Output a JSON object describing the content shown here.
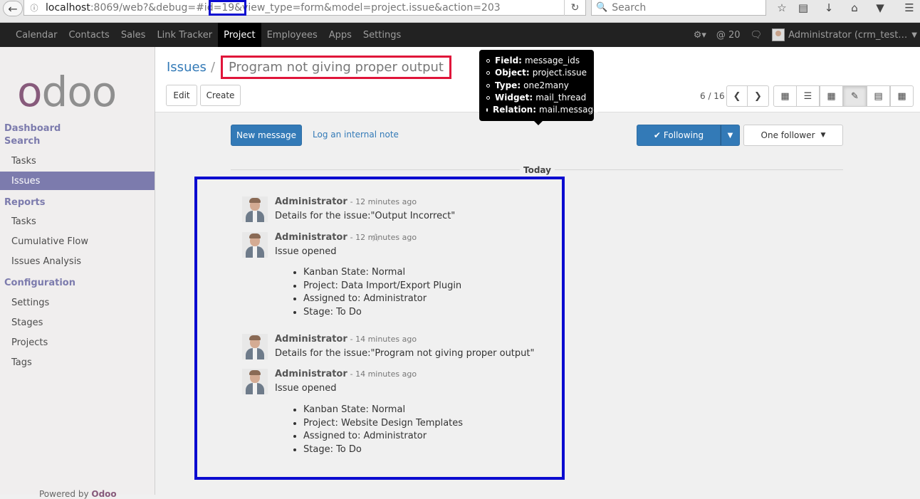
{
  "browser": {
    "url_host": "localhost",
    "url_rest": ":8069/web?&debug=#id=19&view_type=form&model=project.issue&action=203",
    "search_placeholder": "Search",
    "icons": [
      "back-arrow-icon",
      "info-icon",
      "reload-icon",
      "search-icon",
      "bookmark-star-icon",
      "reading-list-icon",
      "download-icon",
      "home-icon",
      "pocket-icon",
      "hamburger-menu-icon"
    ]
  },
  "topnav": {
    "items": [
      "Calendar",
      "Contacts",
      "Sales",
      "Link Tracker",
      "Project",
      "Employees",
      "Apps",
      "Settings"
    ],
    "active": "Project",
    "mentions_count": "@ 20",
    "user_label": "Administrator (crm_test…",
    "debug_icon": "bug-icon"
  },
  "sidebar": {
    "logo_text": "odoo",
    "dashboard": "Dashboard",
    "search": "Search",
    "section1_items": [
      "Tasks",
      "Issues"
    ],
    "reports": "Reports",
    "reports_items": [
      "Tasks",
      "Cumulative Flow",
      "Issues Analysis"
    ],
    "configuration": "Configuration",
    "config_items": [
      "Settings",
      "Stages",
      "Projects",
      "Tags"
    ],
    "powered_by": "Powered by",
    "powered_brand": "Odoo"
  },
  "control_panel": {
    "breadcrumb_parent": "Issues",
    "breadcrumb_sep": "/",
    "record_title": "Program not giving proper output",
    "edit_label": "Edit",
    "create_label": "Create",
    "pager": "6 / 16"
  },
  "tooltip": {
    "rows": [
      {
        "k": "Field:",
        "v": "message_ids"
      },
      {
        "k": "Object:",
        "v": "project.issue"
      },
      {
        "k": "Type:",
        "v": "one2many"
      },
      {
        "k": "Widget:",
        "v": "mail_thread"
      },
      {
        "k": "Relation:",
        "v": "mail.message"
      }
    ]
  },
  "chatter": {
    "new_message": "New message",
    "log_note": "Log an internal note",
    "following": "Following",
    "followers": "One follower",
    "day_label": "Today",
    "messages": [
      {
        "author": "Administrator",
        "ago": "- 12 minutes ago",
        "body": "Details for the issue:\"Output Incorrect\"",
        "tracking": []
      },
      {
        "author": "Administrator",
        "ago": "- 12 minutes ago",
        "body": "Issue opened",
        "tracking": [
          "Kanban State: Normal",
          "Project: Data Import/Export Plugin",
          "Assigned to: Administrator",
          "Stage: To Do"
        ]
      },
      {
        "author": "Administrator",
        "ago": "- 14 minutes ago",
        "body": "Details for the issue:\"Program not giving proper output\"",
        "tracking": []
      },
      {
        "author": "Administrator",
        "ago": "- 14 minutes ago",
        "body": "Issue opened",
        "tracking": [
          "Kanban State: Normal",
          "Project: Website Design Templates",
          "Assigned to: Administrator",
          "Stage: To Do"
        ]
      }
    ]
  },
  "colors": {
    "brand": "#875a7b",
    "sidebar_accent": "#7c7bad",
    "primary": "#337ab7",
    "highlight_red": "#e0153a",
    "highlight_blue": "#0b0bd0"
  }
}
